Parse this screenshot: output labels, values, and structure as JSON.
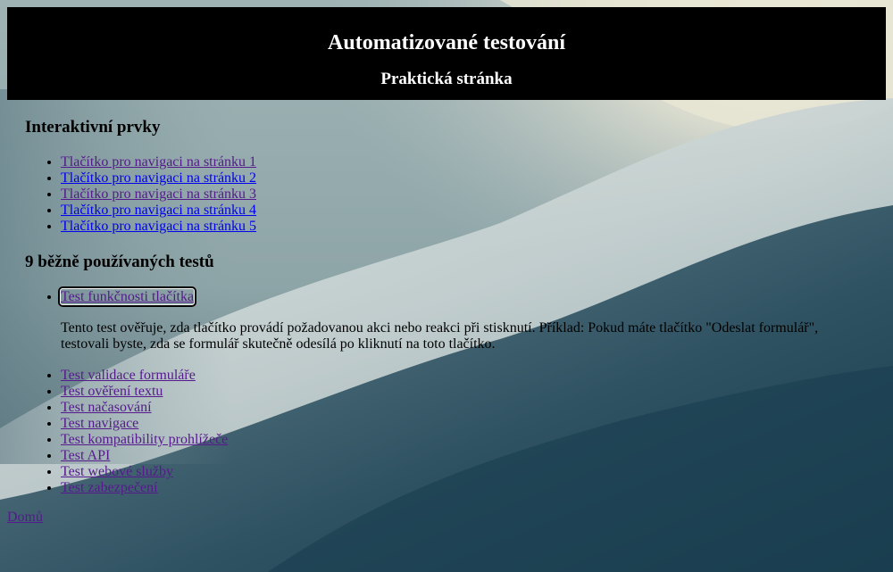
{
  "header": {
    "title": "Automatizované testování",
    "subtitle": "Praktická stránka"
  },
  "interactive": {
    "heading": "Interaktivní prvky",
    "links": [
      {
        "label": "Tlačítko pro navigaci na stránku 1",
        "visited": true
      },
      {
        "label": "Tlačítko pro navigaci na stránku 2",
        "visited": false
      },
      {
        "label": "Tlačítko pro navigaci na stránku 3",
        "visited": true
      },
      {
        "label": "Tlačítko pro navigaci na stránku 4",
        "visited": false
      },
      {
        "label": "Tlačítko pro navigaci na stránku 5",
        "visited": false
      }
    ]
  },
  "tests": {
    "heading": "9 běžně používaných testů",
    "first": {
      "label": "Test funkčnosti tlačítka",
      "description": "Tento test ověřuje, zda tlačítko provádí požadovanou akci nebo reakci při stisknutí. Příklad: Pokud máte tlačítko \"Odeslat formulář\", testovali byste, zda se formulář skutečně odesílá po kliknutí na toto tlačítko."
    },
    "links": [
      "Test validace formuláře",
      "Test ověření textu",
      "Test načasování",
      "Test navigace",
      "Test kompatibility prohlížeče",
      "Test API",
      "Test webové služby",
      "Test zabezpečení"
    ]
  },
  "footer": {
    "home_label": "Domů"
  },
  "colors": {
    "link_visited": "#551a8b",
    "link_unvisited": "#0000ee",
    "header_bg": "#000000",
    "header_text": "#ffffff"
  }
}
